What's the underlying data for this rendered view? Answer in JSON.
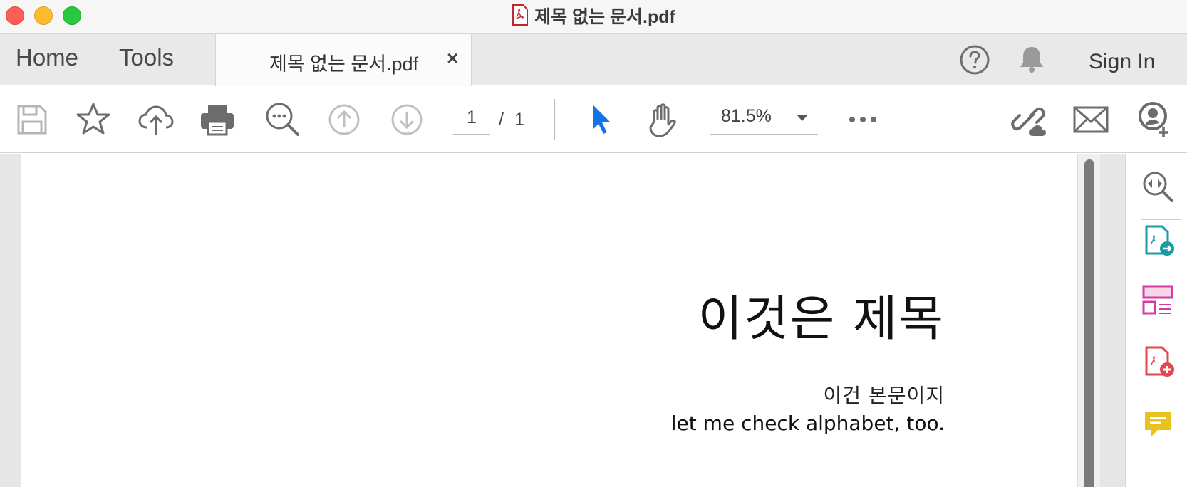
{
  "window": {
    "title": "제목 없는 문서.pdf"
  },
  "tabs": {
    "home": "Home",
    "tools": "Tools",
    "document": "제목 없는 문서.pdf",
    "close": "×",
    "sign_in": "Sign In"
  },
  "toolbar": {
    "icons": [
      "save-icon",
      "bookmark-star-icon",
      "upload-cloud-icon",
      "print-icon",
      "search-zoom-icon",
      "page-up-icon",
      "page-down-icon",
      "select-cursor-icon",
      "hand-pan-icon",
      "more-icon",
      "share-link-icon",
      "email-icon",
      "add-user-icon"
    ],
    "page_current": "1",
    "page_separator": "/",
    "page_total": "1",
    "zoom": "81.5%"
  },
  "document": {
    "title": "이것은 제목",
    "body_line1": "이건 본문이지",
    "body_line2": "let me check alphabet, too."
  },
  "right_rail": {
    "icons": [
      "zoom-compare-icon",
      "export-pdf-icon",
      "organize-pages-icon",
      "create-pdf-icon",
      "comment-icon"
    ]
  },
  "colors": {
    "accent_blue": "#1473e6",
    "teal": "#1a9ba3",
    "magenta": "#d23c9e",
    "red": "#e34850",
    "yellow": "#e8c21d"
  }
}
